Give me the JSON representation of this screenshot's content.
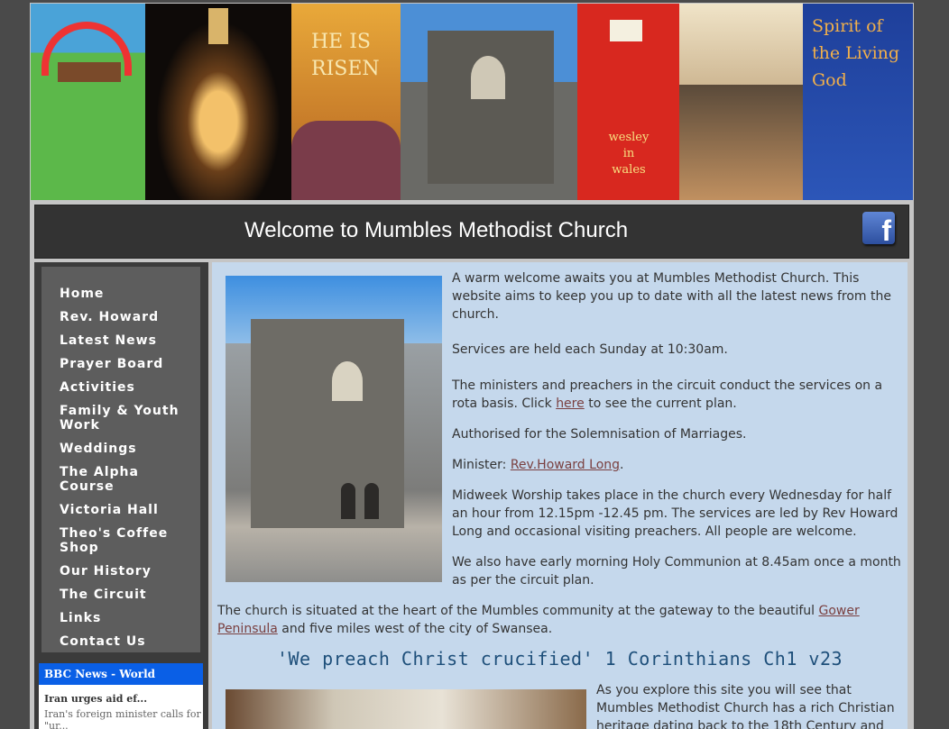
{
  "banner": {
    "panel3_text": "HE IS RISEN",
    "panel5_text": "wesley in wales",
    "panel7_text": "Spirit of the Living God"
  },
  "header": {
    "title": "Welcome to Mumbles Methodist Church",
    "facebook_letter": "f"
  },
  "nav": {
    "items": [
      "Home",
      "Rev. Howard",
      "Latest News",
      "Prayer Board",
      "Activities",
      "Family & Youth Work",
      "Weddings",
      "The Alpha Course",
      "Victoria Hall",
      "Theo's Coffee Shop",
      "Our History",
      "The Circuit",
      "Links",
      "Contact Us"
    ]
  },
  "bbc": {
    "header": "BBC News - World",
    "headline": "Iran urges aid ef...",
    "summary": "Iran's foreign minister calls for \"ur..."
  },
  "content": {
    "p1": "A warm welcome awaits you at Mumbles Methodist Church. This website aims to keep you up to date with all the latest news from the church.",
    "p2": "Services are held each Sunday at 10:30am.",
    "p3_before": "The ministers and preachers in the circuit conduct the services on a rota basis. Click ",
    "p3_link": "here",
    "p3_after": " to see the current plan.",
    "p4": "Authorised for the Solemnisation of Marriages.",
    "p5_label": "Minister: ",
    "p5_link": "Rev.Howard Long",
    "p5_after": ".",
    "p6": "Midweek Worship takes place in the church every Wednesday for half an hour from 12.15pm -12.45 pm. The services are led by Rev Howard Long and occasional visiting preachers. All people are welcome.",
    "p7": "We also have early morning Holy Communion at 8.45am once a month as per the circuit plan.",
    "p8_before": "The church is situated at the heart of the Mumbles community at the gateway to the beautiful ",
    "p8_link": "Gower Peninsula",
    "p8_after": " and five miles west of the city of Swansea.",
    "quote": "'We preach Christ crucified' 1 Corinthians Ch1 v23",
    "p9": "As you explore this site you will see that Mumbles Methodist Church has a rich Christian heritage dating back to the 18th Century and"
  }
}
